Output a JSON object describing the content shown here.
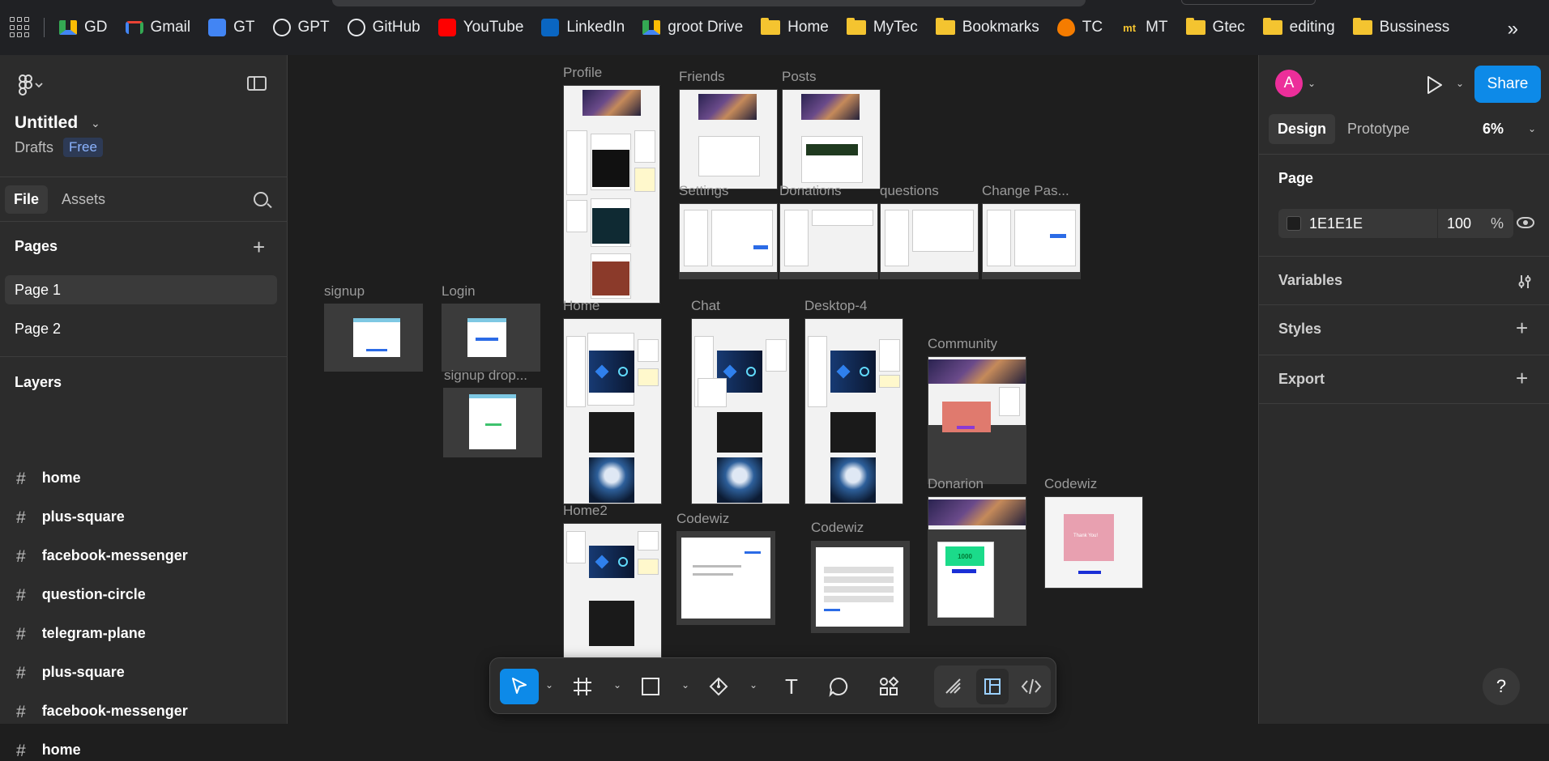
{
  "bookmarks": [
    {
      "label": "GD",
      "icon": "google-drive-icon",
      "color": "#34a853"
    },
    {
      "label": "Gmail",
      "icon": "gmail-icon",
      "color": "#ea4335"
    },
    {
      "label": "GT",
      "icon": "google-translate-icon",
      "color": "#4285f4"
    },
    {
      "label": "GPT",
      "icon": "openai-icon",
      "color": "#e8eaed"
    },
    {
      "label": "GitHub",
      "icon": "github-icon",
      "color": "#e8eaed"
    },
    {
      "label": "YouTube",
      "icon": "youtube-icon",
      "color": "#ff0000"
    },
    {
      "label": "LinkedIn",
      "icon": "linkedin-icon",
      "color": "#0a66c2"
    },
    {
      "label": "groot Drive",
      "icon": "google-drive-icon",
      "color": "#34a853"
    },
    {
      "label": "Home",
      "icon": "folder-icon",
      "color": "#f4c430"
    },
    {
      "label": "MyTec",
      "icon": "folder-icon",
      "color": "#f4c430"
    },
    {
      "label": "Bookmarks",
      "icon": "folder-icon",
      "color": "#f4c430"
    },
    {
      "label": "TC",
      "icon": "flame-icon",
      "color": "#f57c00"
    },
    {
      "label": "MT",
      "icon": "mt-icon",
      "color": "#f4c430"
    },
    {
      "label": "Gtec",
      "icon": "folder-icon",
      "color": "#f4c430"
    },
    {
      "label": "editing",
      "icon": "folder-icon",
      "color": "#f4c430"
    },
    {
      "label": "Bussiness",
      "icon": "folder-icon",
      "color": "#f4c430"
    }
  ],
  "bookmarks_more": "»",
  "left_panel": {
    "file_title": "Untitled",
    "location": "Drafts",
    "plan_badge": "Free",
    "tabs": {
      "file": "File",
      "assets": "Assets"
    },
    "pages_heading": "Pages",
    "pages": [
      "Page 1",
      "Page 2"
    ],
    "active_page": "Page 1",
    "layers_heading": "Layers",
    "layers": [
      "home",
      "plus-square",
      "facebook-messenger",
      "question-circle",
      "telegram-plane",
      "plus-square",
      "facebook-messenger",
      "home"
    ]
  },
  "canvas": {
    "frames": {
      "profile": "Profile",
      "friends": "Friends",
      "posts": "Posts",
      "settings": "Settings",
      "donations": "Donations",
      "questions": "questions",
      "change_password": "Change Pas...",
      "signup": "signup",
      "login": "Login",
      "signup_drop": "signup drop...",
      "home": "Home",
      "chat": "Chat",
      "desktop4": "Desktop-4",
      "community": "Community",
      "home2": "Home2",
      "codewiz1": "Codewiz",
      "codewiz2": "Codewiz",
      "donarion": "Donarion",
      "codewiz3": "Codewiz"
    },
    "donarion_amount": "1000",
    "codewiz3_button": "Thank You!"
  },
  "toolbar": {
    "tools": [
      "move-tool",
      "frame-tool",
      "rectangle-tool",
      "pen-tool",
      "text-tool",
      "comment-tool",
      "actions-tool"
    ],
    "active_tool": "move-tool",
    "modes": [
      "draw-mode",
      "design-mode",
      "dev-mode"
    ],
    "active_mode": "design-mode",
    "text_tool_label": "T"
  },
  "right_panel": {
    "avatar_initial": "A",
    "avatar_color": "#ec2e9a",
    "share_label": "Share",
    "tabs": {
      "design": "Design",
      "prototype": "Prototype"
    },
    "zoom": "6%",
    "page_heading": "Page",
    "background_hex": "1E1E1E",
    "background_opacity": "100",
    "percent_sign": "%",
    "variables": "Variables",
    "styles": "Styles",
    "export": "Export",
    "help": "?"
  },
  "colors": {
    "accent": "#0d8ae8",
    "canvas_bg": "#1e1e1e",
    "panel_bg": "#2c2c2c"
  }
}
